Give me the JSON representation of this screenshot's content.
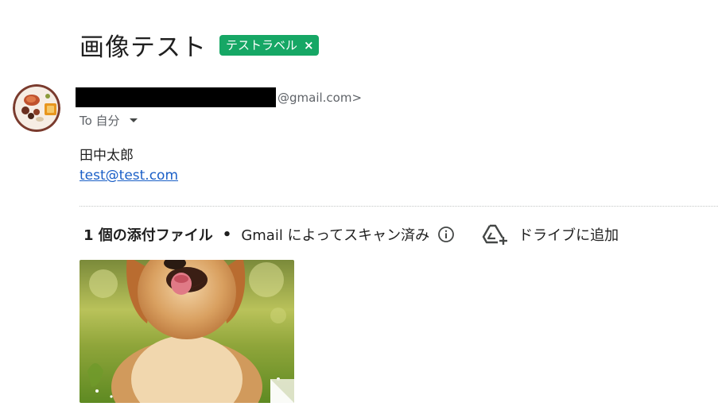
{
  "subject": "画像テスト",
  "label": {
    "text": "テストラベル",
    "close": "×",
    "color": "#16a765"
  },
  "sender": {
    "email": "@gmail.com>"
  },
  "recipient": {
    "text": "To 自分"
  },
  "body": {
    "name": "田中太郎",
    "email_link": "test@test.com"
  },
  "attachments": {
    "count_text": "1 個の添付ファイル",
    "separator": "•",
    "scan_text": "Gmail によってスキャン済み",
    "drive_label": "ドライブに追加",
    "items": [
      {
        "type": "image",
        "depicts": "golden-retriever-photo"
      }
    ]
  },
  "icons": {
    "info": "info-icon",
    "drive": "drive-add-icon",
    "dropdown": "chevron-down-icon"
  },
  "colors": {
    "link": "#1a5fc7",
    "muted": "#5f6368"
  }
}
